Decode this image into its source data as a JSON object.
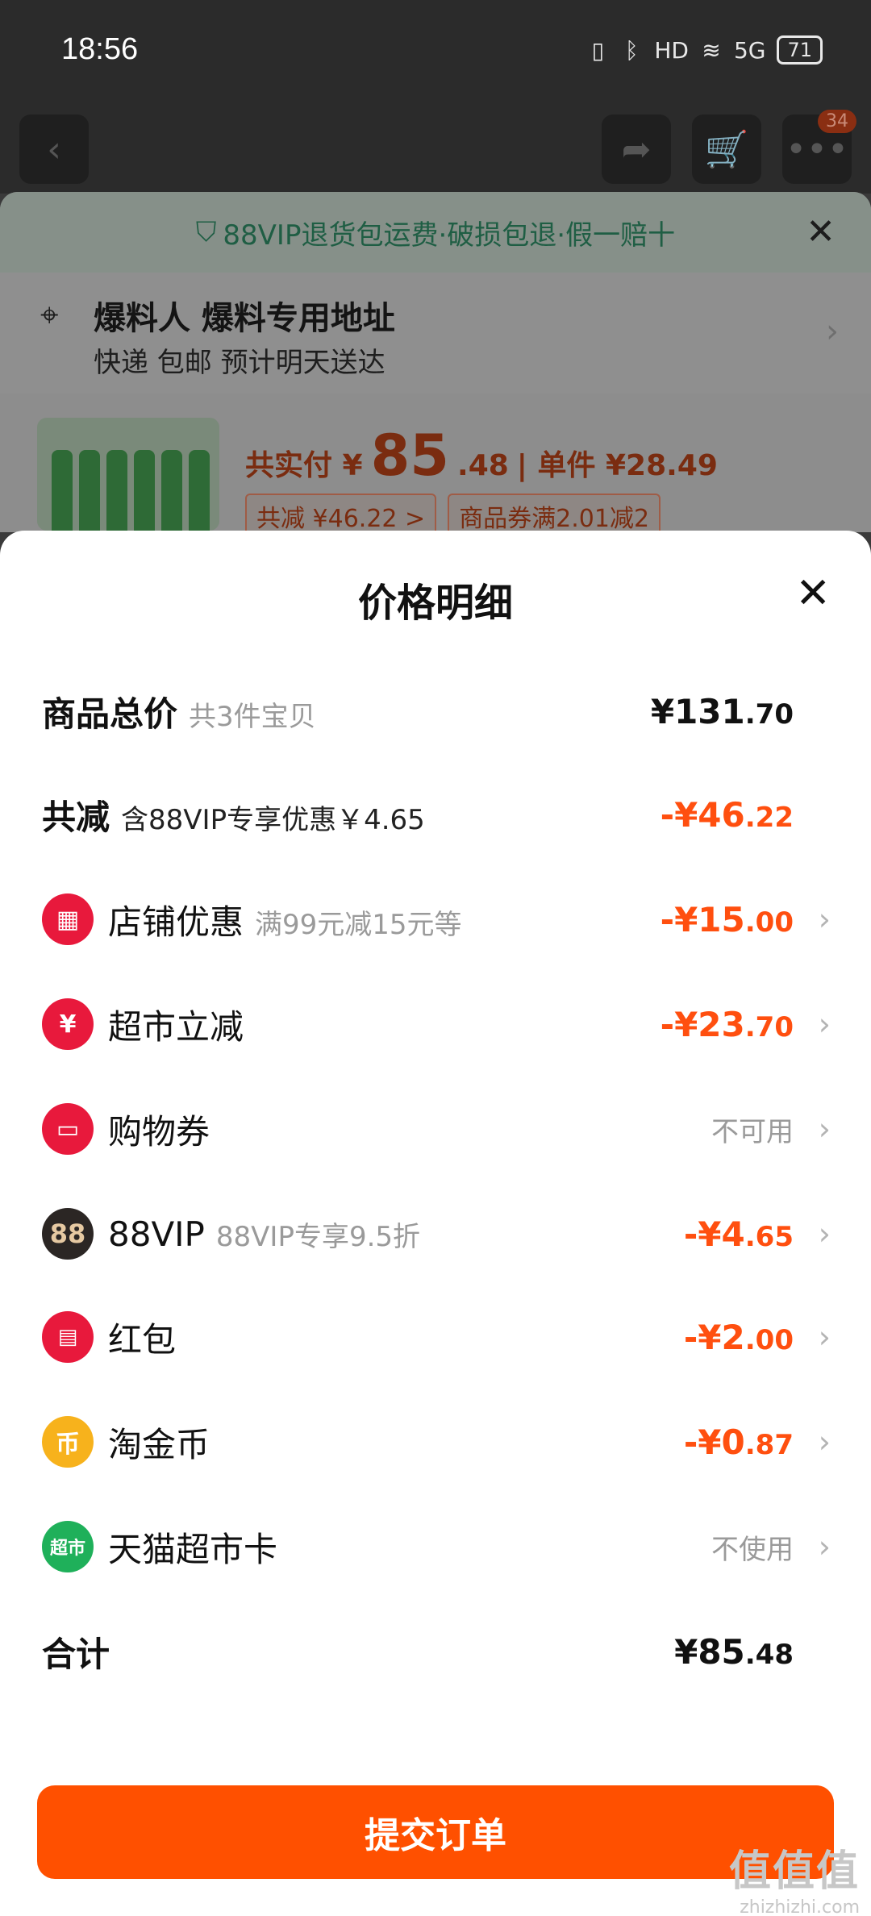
{
  "status_bar": {
    "time": "18:56",
    "icons": [
      "vibrate-icon",
      "bluetooth-icon",
      "hd-icon",
      "wifi-icon",
      "5g-signal-icon"
    ],
    "hd_label": "HD",
    "network_label": "5G",
    "battery": "71"
  },
  "nav": {
    "cart_badge": "34"
  },
  "background_page": {
    "vip_banner": "88VIP退货包运费·破损包退·假一赔十",
    "address_title": "爆料人 爆料专用地址",
    "address_sub": "快递 包邮 预计明天送达",
    "price_label": "共实付 ¥",
    "price_big": "85",
    "price_small": ".48",
    "unit_price": "| 单件 ¥28.49",
    "tag_discount": "共减 ¥46.22 >",
    "tag_coupon": "商品券满2.01减2"
  },
  "sheet": {
    "title": "价格明细",
    "rows": {
      "total_price": {
        "label": "商品总价",
        "sub": "共3件宝贝",
        "value": "¥131",
        "cents": ".70"
      },
      "total_discount": {
        "label": "共减",
        "sub": "含88VIP专享优惠￥4.65",
        "value": "-¥46",
        "cents": ".22"
      },
      "store_discount": {
        "label": "店铺优惠",
        "sub": "满99元减15元等",
        "value": "-¥15",
        "cents": ".00"
      },
      "supermarket_discount": {
        "label": "超市立减",
        "value": "-¥23",
        "cents": ".70"
      },
      "shopping_coupon": {
        "label": "购物券",
        "value": "不可用"
      },
      "vip88": {
        "icon_text": "88",
        "label": "88VIP",
        "sub": "88VIP专享9.5折",
        "value": "-¥4",
        "cents": ".65"
      },
      "red_packet": {
        "label": "红包",
        "value": "-¥2",
        "cents": ".00"
      },
      "taojinbi": {
        "icon_text": "币",
        "label": "淘金币",
        "value": "-¥0",
        "cents": ".87"
      },
      "tmall_card": {
        "icon_text": "超市",
        "label": "天猫超市卡",
        "value": "不使用"
      },
      "sum": {
        "label": "合计",
        "value": "¥85",
        "cents": ".48"
      }
    },
    "submit": "提交订单"
  },
  "watermark": {
    "main": "值值值",
    "sub": "zhizhizhi.com"
  },
  "colors": {
    "accent": "#ff5000",
    "price_red": "#ff4f0f",
    "vip_green": "#1f5e44"
  }
}
